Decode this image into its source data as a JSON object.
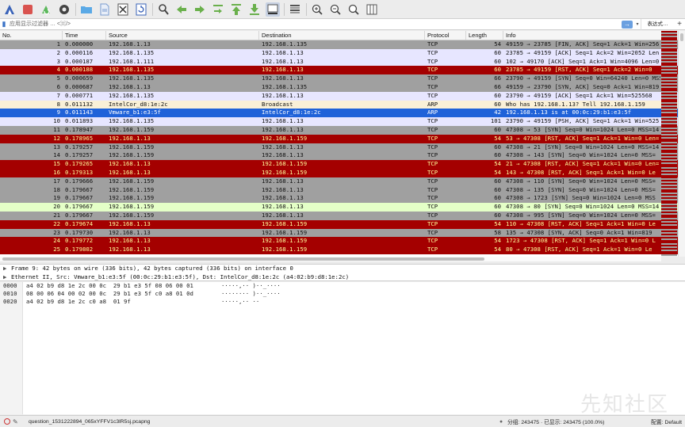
{
  "toolbar": {
    "icons": [
      "shark-fin-icon",
      "stop-icon",
      "restart-icon",
      "gear-icon",
      "open-folder-icon",
      "save-file-icon",
      "close-file-icon",
      "reload-icon",
      "find-icon",
      "back-icon",
      "forward-icon",
      "goto-icon",
      "first-icon",
      "last-icon",
      "autoscroll-icon",
      "colorize-icon",
      "zoom-in-icon",
      "zoom-out-icon",
      "zoom-reset-icon",
      "resize-columns-icon"
    ]
  },
  "filter": {
    "placeholder": "应用显示过滤器 … <⌘/>",
    "expression_label": "表达式…",
    "plus_label": "+"
  },
  "packet_list": {
    "columns": {
      "no": "No.",
      "time": "Time",
      "source": "Source",
      "destination": "Destination",
      "protocol": "Protocol",
      "length": "Length",
      "info": "Info"
    },
    "rows": [
      {
        "no": "1",
        "time": "0.000000",
        "src": "192.168.1.13",
        "dst": "192.168.1.135",
        "proto": "TCP",
        "len": "54",
        "info": "49159 → 23785 [FIN, ACK] Seq=1 Ack=1 Win=256",
        "style": "gray"
      },
      {
        "no": "2",
        "time": "0.000116",
        "src": "192.168.1.135",
        "dst": "192.168.1.13",
        "proto": "TCP",
        "len": "60",
        "info": "23785 → 49159 [ACK] Seq=1 Ack=2 Win=2052 Len",
        "style": "lav"
      },
      {
        "no": "3",
        "time": "0.000187",
        "src": "192.168.1.111",
        "dst": "192.168.1.13",
        "proto": "TCP",
        "len": "60",
        "info": "102 → 49170 [ACK] Seq=1 Ack=1 Win=4096 Len=0",
        "style": "lav"
      },
      {
        "no": "4",
        "time": "0.000188",
        "src": "192.168.1.135",
        "dst": "192.168.1.13",
        "proto": "TCP",
        "len": "60",
        "info": "23785 → 49159 [RST, ACK] Seq=1 Ack=2 Win=0",
        "style": "red"
      },
      {
        "no": "5",
        "time": "0.000659",
        "src": "192.168.1.135",
        "dst": "192.168.1.13",
        "proto": "TCP",
        "len": "66",
        "info": "23790 → 49159 [SYN] Seq=0 Win=64240 Len=0 MSS",
        "style": "gray"
      },
      {
        "no": "6",
        "time": "0.000687",
        "src": "192.168.1.13",
        "dst": "192.168.1.135",
        "proto": "TCP",
        "len": "66",
        "info": "49159 → 23790 [SYN, ACK] Seq=0 Ack=1 Win=819",
        "style": "gray"
      },
      {
        "no": "7",
        "time": "0.000771",
        "src": "192.168.1.135",
        "dst": "192.168.1.13",
        "proto": "TCP",
        "len": "60",
        "info": "23790 → 49159 [ACK] Seq=1 Ack=1 Win=525568",
        "style": "lav"
      },
      {
        "no": "8",
        "time": "0.011132",
        "src": "IntelCor_d8:1e:2c",
        "dst": "Broadcast",
        "proto": "ARP",
        "len": "60",
        "info": "Who has 192.168.1.13? Tell 192.168.1.159",
        "style": "yel"
      },
      {
        "no": "9",
        "time": "0.011143",
        "src": "Vmware_b1:e3:5f",
        "dst": "IntelCor_d8:1e:2c",
        "proto": "ARP",
        "len": "42",
        "info": "192.168.1.13 is at 00:0c:29:b1:e3:5f",
        "style": "sel"
      },
      {
        "no": "10",
        "time": "0.011893",
        "src": "192.168.1.135",
        "dst": "192.168.1.13",
        "proto": "TCP",
        "len": "101",
        "info": "23790 → 49159 [PSH, ACK] Seq=1 Ack=1 Win=525",
        "style": "lav"
      },
      {
        "no": "11",
        "time": "0.178947",
        "src": "192.168.1.159",
        "dst": "192.168.1.13",
        "proto": "TCP",
        "len": "60",
        "info": "47308 → 53 [SYN] Seq=0 Win=1024 Len=0 MSS=14",
        "style": "gray"
      },
      {
        "no": "12",
        "time": "0.178965",
        "src": "192.168.1.13",
        "dst": "192.168.1.159",
        "proto": "TCP",
        "len": "54",
        "info": "53 → 47308 [RST, ACK] Seq=1 Ack=1 Win=0 Len=",
        "style": "red"
      },
      {
        "no": "13",
        "time": "0.179257",
        "src": "192.168.1.159",
        "dst": "192.168.1.13",
        "proto": "TCP",
        "len": "60",
        "info": "47308 → 21 [SYN] Seq=0 Win=1024 Len=0 MSS=14",
        "style": "gray"
      },
      {
        "no": "14",
        "time": "0.179257",
        "src": "192.168.1.159",
        "dst": "192.168.1.13",
        "proto": "TCP",
        "len": "60",
        "info": "47308 → 143 [SYN] Seq=0 Win=1024 Len=0 MSS=",
        "style": "gray"
      },
      {
        "no": "15",
        "time": "0.179265",
        "src": "192.168.1.13",
        "dst": "192.168.1.159",
        "proto": "TCP",
        "len": "54",
        "info": "21 → 47308 [RST, ACK] Seq=1 Ack=1 Win=0 Len=",
        "style": "red"
      },
      {
        "no": "16",
        "time": "0.179313",
        "src": "192.168.1.13",
        "dst": "192.168.1.159",
        "proto": "TCP",
        "len": "54",
        "info": "143 → 47308 [RST, ACK] Seq=1 Ack=1 Win=0 Le",
        "style": "red"
      },
      {
        "no": "17",
        "time": "0.179666",
        "src": "192.168.1.159",
        "dst": "192.168.1.13",
        "proto": "TCP",
        "len": "60",
        "info": "47308 → 110 [SYN] Seq=0 Win=1024 Len=0 MSS=",
        "style": "gray"
      },
      {
        "no": "18",
        "time": "0.179667",
        "src": "192.168.1.159",
        "dst": "192.168.1.13",
        "proto": "TCP",
        "len": "60",
        "info": "47308 → 135 [SYN] Seq=0 Win=1024 Len=0 MSS=",
        "style": "gray"
      },
      {
        "no": "19",
        "time": "0.179667",
        "src": "192.168.1.159",
        "dst": "192.168.1.13",
        "proto": "TCP",
        "len": "60",
        "info": "47308 → 1723 [SYN] Seq=0 Win=1024 Len=0 MSS",
        "style": "gray"
      },
      {
        "no": "20",
        "time": "0.179667",
        "src": "192.168.1.159",
        "dst": "192.168.1.13",
        "proto": "TCP",
        "len": "60",
        "info": "47308 → 80 [SYN] Seq=0 Win=1024 Len=0 MSS=14",
        "style": "grn"
      },
      {
        "no": "21",
        "time": "0.179667",
        "src": "192.168.1.159",
        "dst": "192.168.1.13",
        "proto": "TCP",
        "len": "60",
        "info": "47308 → 995 [SYN] Seq=0 Win=1024 Len=0 MSS=",
        "style": "gray"
      },
      {
        "no": "22",
        "time": "0.179674",
        "src": "192.168.1.13",
        "dst": "192.168.1.159",
        "proto": "TCP",
        "len": "54",
        "info": "110 → 47308 [RST, ACK] Seq=1 Ack=1 Win=0 Le",
        "style": "red"
      },
      {
        "no": "23",
        "time": "0.179730",
        "src": "192.168.1.13",
        "dst": "192.168.1.159",
        "proto": "TCP",
        "len": "58",
        "info": "135 → 47308 [SYN, ACK] Seq=0 Ack=1 Win=819",
        "style": "gray"
      },
      {
        "no": "24",
        "time": "0.179772",
        "src": "192.168.1.13",
        "dst": "192.168.1.159",
        "proto": "TCP",
        "len": "54",
        "info": "1723 → 47308 [RST, ACK] Seq=1 Ack=1 Win=0 L",
        "style": "red"
      },
      {
        "no": "25",
        "time": "0.179802",
        "src": "192.168.1.13",
        "dst": "192.168.1.159",
        "proto": "TCP",
        "len": "54",
        "info": "80 → 47308 [RST, ACK] Seq=1 Ack=1 Win=0 Le",
        "style": "red"
      }
    ]
  },
  "details": [
    {
      "text": "Frame 9: 42 bytes on wire (336 bits), 42 bytes captured (336 bits) on interface 0"
    },
    {
      "text": "Ethernet II, Src: Vmware_b1:e3:5f (00:0c:29:b1:e3:5f), Dst: IntelCor_d8:1e:2c (a4:02:b9:d8:1e:2c)"
    }
  ],
  "bytes": [
    {
      "offset": "0000",
      "hex": "a4 02 b9 d8 1e 2c 00 0c  29 b1 e3 5f 08 06 00 01",
      "ascii": "·····,·· )··_····"
    },
    {
      "offset": "0010",
      "hex": "08 00 06 04 00 02 00 0c  29 b1 e3 5f c0 a8 01 0d",
      "ascii": "········ )··_····"
    },
    {
      "offset": "0020",
      "hex": "a4 02 b9 d8 1e 2c c0 a8  01 9f",
      "ascii": "·····,·· ··"
    }
  ],
  "watermark": "先知社区",
  "status": {
    "file": "question_1531222894_065xYFFV1c3lR5sj.pcapng",
    "counts": "分组: 243475 · 已显示: 243475 (100.0%)",
    "profile": "配置: Default"
  },
  "colors": {
    "gray": "#a0a0a0",
    "lavender": "#e7e6ff",
    "red": "#a40000",
    "red_text": "#fffc9c",
    "yellow": "#faf0d7",
    "selected": "#1f62d9",
    "green": "#e4ffc7"
  }
}
